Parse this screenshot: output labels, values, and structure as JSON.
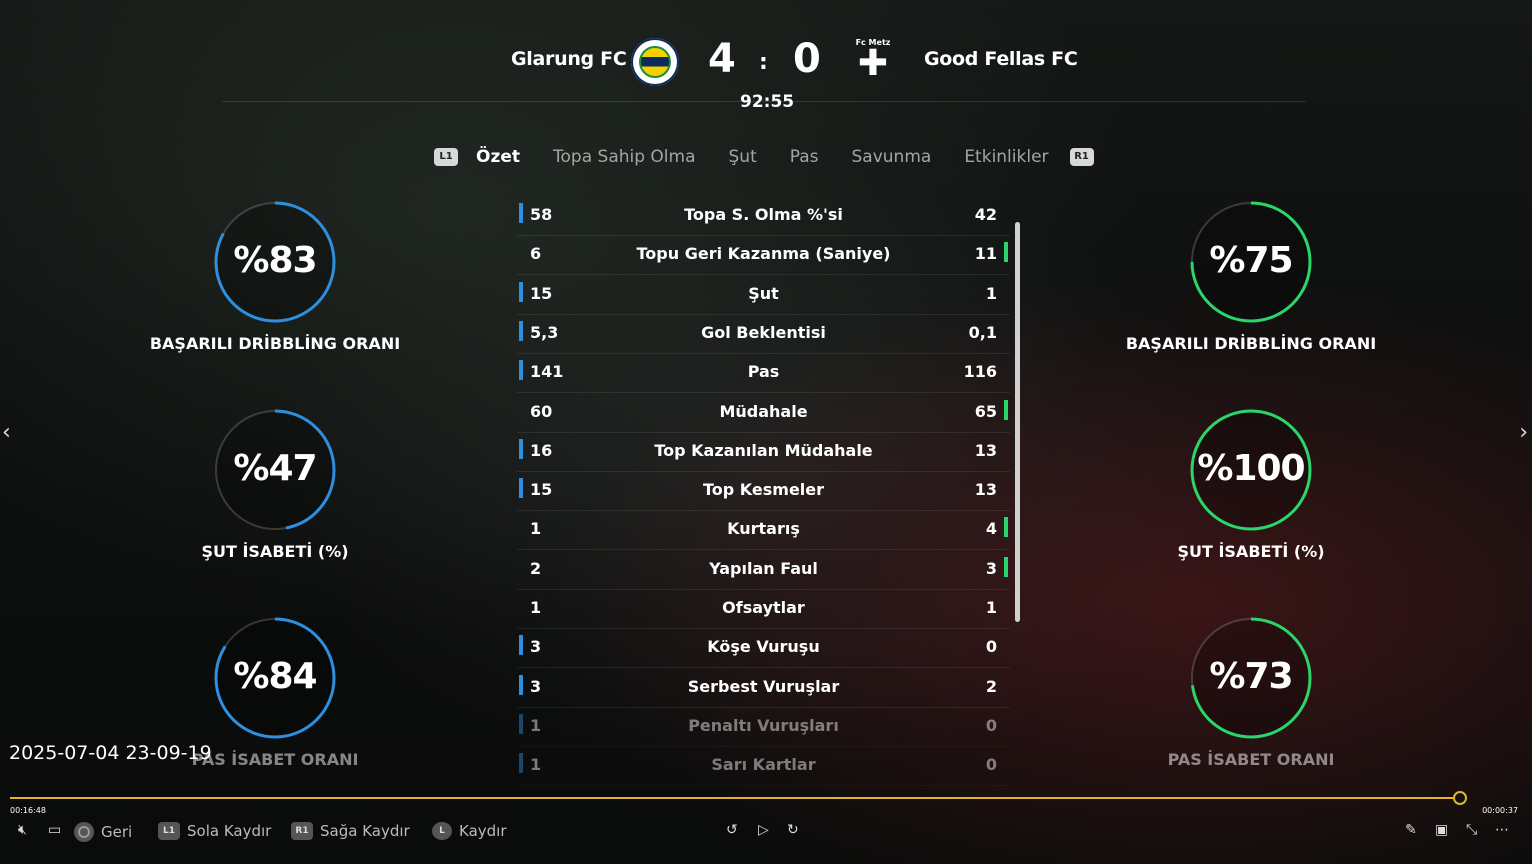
{
  "match": {
    "home_team": "Glarung FC",
    "away_team": "Good Fellas FC",
    "away_crest_label": "Fc Metz",
    "away_crest_glyph": "✚",
    "home_score": "4",
    "away_score": "0",
    "separator": ":",
    "clock": "92:55"
  },
  "tabs": {
    "left_button": "L1",
    "right_button": "R1",
    "items": [
      "Özet",
      "Topa Sahip Olma",
      "Şut",
      "Pas",
      "Savunma",
      "Etkinlikler"
    ],
    "active_index": 0
  },
  "stats": [
    {
      "label": "Topa S. Olma %'si",
      "home": "58",
      "away": "42",
      "leader": "home"
    },
    {
      "label": "Topu Geri Kazanma (Saniye)",
      "home": "6",
      "away": "11",
      "leader": "away"
    },
    {
      "label": "Şut",
      "home": "15",
      "away": "1",
      "leader": "home"
    },
    {
      "label": "Gol Beklentisi",
      "home": "5,3",
      "away": "0,1",
      "leader": "home"
    },
    {
      "label": "Pas",
      "home": "141",
      "away": "116",
      "leader": "home"
    },
    {
      "label": "Müdahale",
      "home": "60",
      "away": "65",
      "leader": "away"
    },
    {
      "label": "Top Kazanılan Müdahale",
      "home": "16",
      "away": "13",
      "leader": "home"
    },
    {
      "label": "Top Kesmeler",
      "home": "15",
      "away": "13",
      "leader": "home"
    },
    {
      "label": "Kurtarış",
      "home": "1",
      "away": "4",
      "leader": "away"
    },
    {
      "label": "Yapılan Faul",
      "home": "2",
      "away": "3",
      "leader": "away"
    },
    {
      "label": "Ofsaytlar",
      "home": "1",
      "away": "1",
      "leader": "none"
    },
    {
      "label": "Köşe Vuruşu",
      "home": "3",
      "away": "0",
      "leader": "home"
    },
    {
      "label": "Serbest Vuruşlar",
      "home": "3",
      "away": "2",
      "leader": "home"
    },
    {
      "label": "Penaltı Vuruşları",
      "home": "1",
      "away": "0",
      "leader": "home"
    },
    {
      "label": "Sarı Kartlar",
      "home": "1",
      "away": "0",
      "leader": "home"
    }
  ],
  "home_rings": [
    {
      "value": "%83",
      "fraction": 0.83,
      "title": "BAŞARILI DRİBBLİNG ORANI"
    },
    {
      "value": "%47",
      "fraction": 0.47,
      "title": "ŞUT İSABETİ (%)"
    },
    {
      "value": "%84",
      "fraction": 0.84,
      "title": "PAS İSABET ORANI"
    }
  ],
  "away_rings": [
    {
      "value": "%75",
      "fraction": 0.75,
      "title": "BAŞARILI DRİBBLİNG ORANI"
    },
    {
      "value": "%100",
      "fraction": 1.0,
      "title": "ŞUT İSABETİ (%)"
    },
    {
      "value": "%73",
      "fraction": 0.73,
      "title": "PAS İSABET ORANI"
    }
  ],
  "colors": {
    "home": "#2e8fe0",
    "away": "#2ad66a",
    "progress": "#e0b52a"
  },
  "player": {
    "timestamp": "2025-07-04 23-09-19",
    "elapsed": "00:16:48",
    "remaining": "00:00:37",
    "progress": 0.995,
    "controls": {
      "back": "Geri",
      "slide_left": "Sola Kaydır",
      "slide_right": "Sağa Kaydır",
      "scroll": "Kaydır",
      "l1": "L1",
      "r1": "R1",
      "l": "L"
    }
  }
}
